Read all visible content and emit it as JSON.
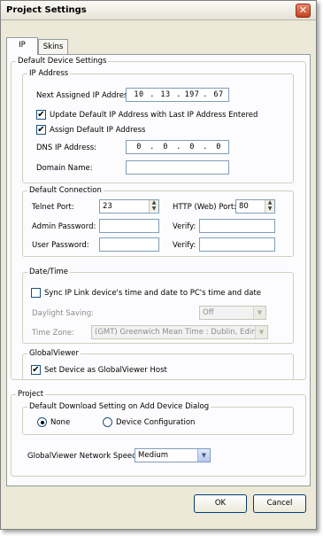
{
  "window": {
    "title": "Project Settings",
    "close_glyph": "✕"
  },
  "tabs": [
    {
      "label": "IP",
      "active": true
    },
    {
      "label": "Skins",
      "active": false
    }
  ],
  "default_device_settings": {
    "legend": "Default Device Settings",
    "ip_address": {
      "legend": "IP Address",
      "next_assigned_label": "Next Assigned IP Address:",
      "next_assigned_octets": [
        "10",
        "13",
        "197",
        "67"
      ],
      "update_default_label": "Update Default IP Address with Last IP Address Entered",
      "update_default_checked": true,
      "assign_default_label": "Assign Default IP Address",
      "assign_default_checked": true,
      "dns_label": "DNS IP Address:",
      "dns_octets": [
        "0",
        "0",
        "0",
        "0"
      ],
      "domain_label": "Domain Name:",
      "domain_value": ""
    },
    "default_connection": {
      "legend": "Default Connection",
      "telnet_label": "Telnet Port:",
      "telnet_value": "23",
      "http_label": "HTTP (Web) Port:",
      "http_value": "80",
      "admin_password_label": "Admin Password:",
      "admin_password_value": "",
      "user_password_label": "User Password:",
      "user_password_value": "",
      "verify_label": "Verify:",
      "verify_admin_value": "",
      "verify_user_value": ""
    },
    "date_time": {
      "legend": "Date/Time",
      "sync_label": "Sync IP Link device's time and date to PC's time and date",
      "sync_checked": false,
      "daylight_label": "Daylight Saving:",
      "daylight_value": "Off",
      "timezone_label": "Time Zone:",
      "timezone_value": "(GMT) Greenwich Mean Time : Dublin, Edinburgh"
    },
    "globalviewer": {
      "legend": "GlobalViewer",
      "set_device_label": "Set Device as GlobalViewer Host",
      "set_device_checked": true
    }
  },
  "project": {
    "legend": "Project",
    "download_group": {
      "legend": "Default Download Setting on Add Device Dialog",
      "none_label": "None",
      "device_config_label": "Device Configuration",
      "selected": "None"
    },
    "network_speed_label": "GlobalViewer Network Speed:",
    "network_speed_value": "Medium"
  },
  "buttons": {
    "ok": "OK",
    "cancel": "Cancel"
  },
  "glyphs": {
    "check": "✔",
    "dropdown": "▼",
    "spin_up": "▲",
    "spin_down": "▼"
  }
}
